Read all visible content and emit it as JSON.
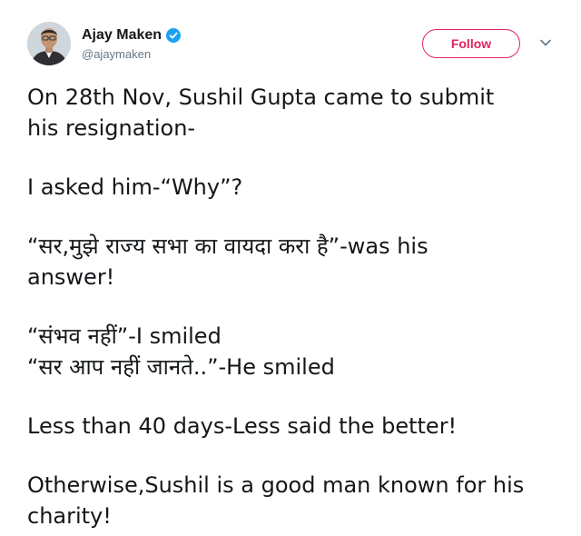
{
  "author": {
    "display_name": "Ajay Maken",
    "handle": "@ajaymaken",
    "verified": true,
    "verified_icon": "verified-badge-icon",
    "avatar_icon": "avatar"
  },
  "actions": {
    "follow_label": "Follow",
    "more_icon": "chevron-down-icon"
  },
  "colors": {
    "follow_accent": "#e0245e",
    "verified_blue": "#1da1f2",
    "text": "#14171a",
    "secondary_text": "#657786"
  },
  "tweet": {
    "paragraphs": [
      [
        "On 28th Nov, Sushil Gupta came to submit",
        "his resignation-"
      ],
      [
        "I asked him-“Why”?"
      ],
      [
        "“सर,मुझे राज्य सभा का वायदा करा है”-was his",
        "answer!"
      ],
      [
        "“संभव नहीं”-I smiled",
        "“सर आप नहीं जानते..”-He smiled"
      ],
      [
        "Less than 40 days-Less said the better!"
      ],
      [
        "Otherwise,Sushil is a good man known for his",
        "charity!"
      ]
    ]
  }
}
